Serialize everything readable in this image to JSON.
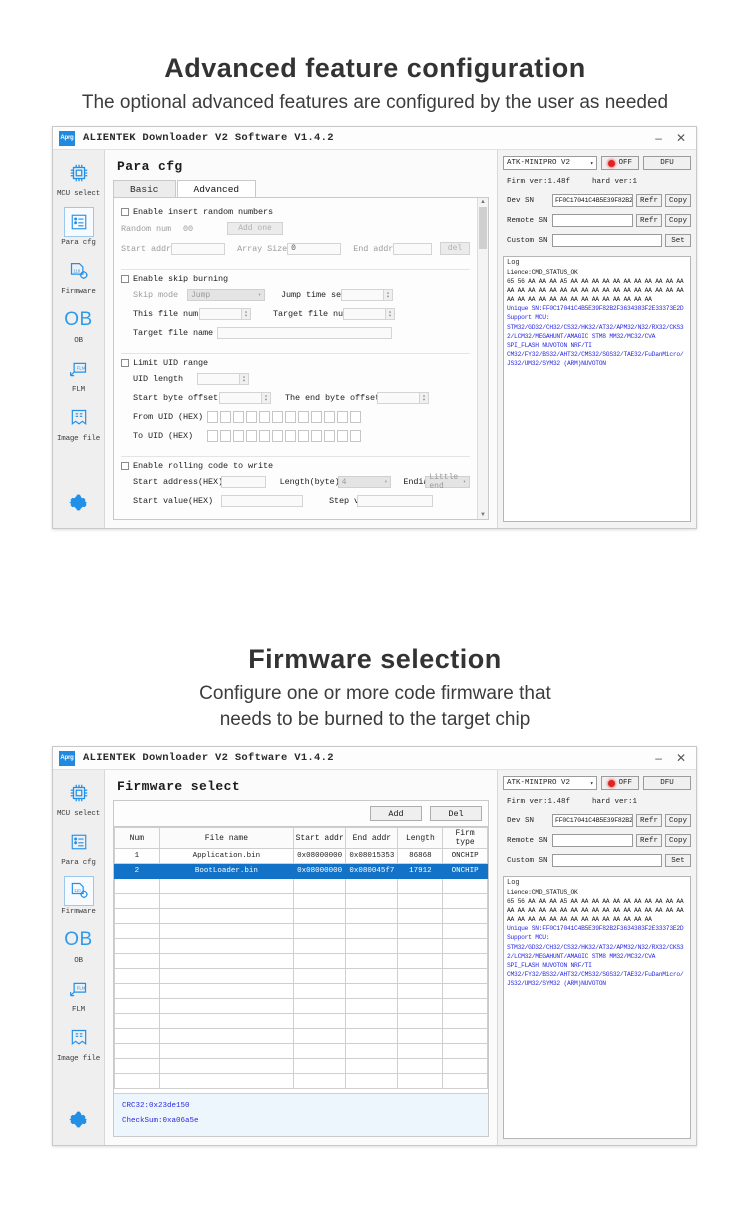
{
  "sections": [
    {
      "title": "Advanced feature configuration",
      "subtitle": "The optional advanced features are configured by the user as needed"
    },
    {
      "title": "Firmware selection",
      "subtitle_line1": "Configure one or more code firmware that",
      "subtitle_line2": "needs to be burned to the target chip"
    }
  ],
  "window": {
    "logo": "Aprg",
    "title": "ALIENTEK  Downloader V2 Software V1.4.2",
    "minimize": "–",
    "close": "✕"
  },
  "sidebar": {
    "items": [
      {
        "label": "MCU select",
        "icon": "chip-icon"
      },
      {
        "label": "Para cfg",
        "icon": "list-icon"
      },
      {
        "label": "Firmware",
        "icon": "firmware-icon"
      },
      {
        "label": "OB",
        "icon": "ob-glyph-icon",
        "glyph": "OB"
      },
      {
        "label": "FLM",
        "icon": "flm-icon"
      },
      {
        "label": "Image file",
        "icon": "bookmark-icon"
      }
    ],
    "settings_icon": "gear-icon"
  },
  "para_cfg": {
    "pane_title": "Para cfg",
    "tabs": [
      {
        "label": "Basic",
        "active": false
      },
      {
        "label": "Advanced",
        "active": true
      }
    ],
    "groups": [
      {
        "checkbox_label": "Enable insert random numbers",
        "fields": {
          "random_num_label": "Random num",
          "random_num_value": "00",
          "add_one_button": "Add one",
          "start_addr_label": "Start addr",
          "start_addr_value": "",
          "array_size_label": "Array Size",
          "array_size_value": "0",
          "end_addr_label": "End addr",
          "end_addr_value": "",
          "del_button": "del"
        }
      },
      {
        "checkbox_label": "Enable skip burning",
        "fields": {
          "skip_mode_label": "Skip mode",
          "skip_mode_value": "Jump",
          "jump_time_label": "Jump time set",
          "jump_time_value": "",
          "this_file_num_label": "This file num",
          "this_file_num_value": "",
          "target_file_num_label": "Target file num",
          "target_file_num_value": "",
          "target_file_name_label": "Target file name",
          "target_file_name_value": ""
        }
      },
      {
        "checkbox_label": "Limit UID range",
        "fields": {
          "uid_length_label": "UID length",
          "uid_length_value": "",
          "start_byte_offset_label": "Start byte offset",
          "start_byte_offset_value": "",
          "end_byte_offset_label": "The end byte offset",
          "end_byte_offset_value": "",
          "from_uid_label": "From UID (HEX)",
          "to_uid_label": "To UID (HEX)",
          "hex_cell_count": 12
        }
      },
      {
        "checkbox_label": "Enable rolling code to write",
        "fields": {
          "start_address_label": "Start address(HEX)",
          "start_address_value": "",
          "length_byte_label": "Length(byte)",
          "length_byte_value": "4",
          "endian_label": "Endia",
          "endian_value": "Little end",
          "start_value_label": "Start value(HEX)",
          "start_value_value": "",
          "step_val_label": "Step val",
          "step_val_value": ""
        }
      }
    ]
  },
  "firmware": {
    "pane_title": "Firmware select",
    "toolbar": {
      "add_button": "Add",
      "del_button": "Del"
    },
    "columns": [
      "Num",
      "File name",
      "Start addr",
      "End addr",
      "Length",
      "Firm type"
    ],
    "rows": [
      {
        "num": "1",
        "file_name": "Application.bin",
        "start_addr": "0x08000000",
        "end_addr": "0x08015353",
        "length": "86868",
        "firm_type": "ONCHIP",
        "selected": false
      },
      {
        "num": "2",
        "file_name": "BootLoader.bin",
        "start_addr": "0x08000000",
        "end_addr": "0x080045f7",
        "length": "17912",
        "firm_type": "ONCHIP",
        "selected": true
      }
    ],
    "empty_row_count": 14,
    "footer": {
      "crc32": "CRC32:0x23de150",
      "checksum": "CheckSum:0xa06a5e"
    }
  },
  "right_panel": {
    "device_select": "ATK-MINIPRO V2",
    "power_state": "OFF",
    "dfu_button": "DFU",
    "firm_ver": "Firm ver:1.48f",
    "hard_ver": "hard ver:1",
    "dev_sn_label": "Dev SN",
    "dev_sn_value": "FF0C17041C4B5E39F82B2F3",
    "remote_sn_label": "Remote SN",
    "remote_sn_value": "",
    "custom_sn_label": "Custom SN",
    "custom_sn_value": "",
    "refr_button": "Refr",
    "copy_button": "Copy",
    "set_button": "Set",
    "log_title": "Log",
    "log_lines": [
      {
        "text": "Lience:CMD_STATUS_OK",
        "color": "black"
      },
      {
        "text": "65 56 AA AA AA A5 AA AA AA AA AA AA AA AA AA AA AA",
        "color": "black"
      },
      {
        "text": "AA AA AA AA AA AA AA AA AA AA AA AA AA AA AA AA AA",
        "color": "black"
      },
      {
        "text": "AA AA AA AA AA AA AA AA AA AA AA AA AA AA",
        "color": "black"
      },
      {
        "text": "Unique SN:FF0C17041C4B5E39F82B2F3634383F2E33373E2D",
        "color": "blue"
      },
      {
        "text": "Support MCU:",
        "color": "blue"
      },
      {
        "text": "STM32/GD32/CH32/CS32/HK32/AT32/APM32/N32/RX32/CKS3",
        "color": "blue"
      },
      {
        "text": "2/LCM32/MEGAHUNT/AMAGIC STM8 MM32/MC32/CVA",
        "color": "blue"
      },
      {
        "text": "SPI_FLASH NUVOTON NRF/TI",
        "color": "blue"
      },
      {
        "text": "CM32/FY32/BS32/AHT32/CMS32/SGS32/TAE32/FuDanMicro/",
        "color": "blue"
      },
      {
        "text": "JS32/UM32/SYM32 (ARM)NUVOTON",
        "color": "blue"
      }
    ]
  }
}
